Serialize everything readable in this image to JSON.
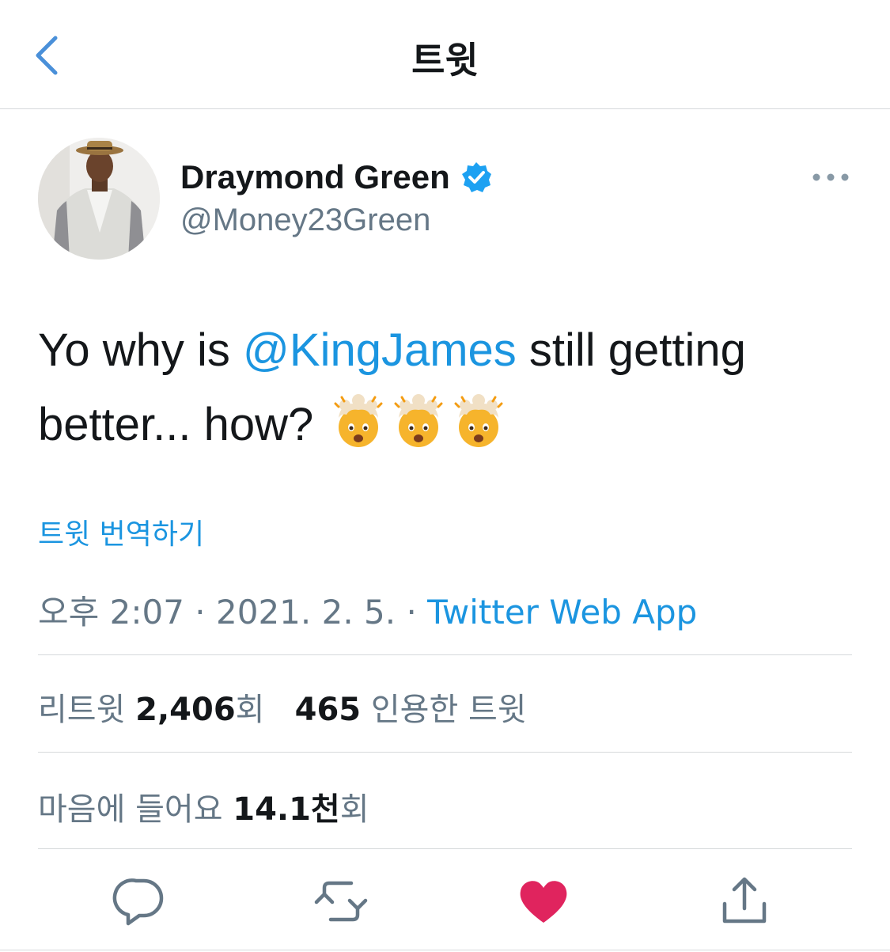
{
  "nav": {
    "title": "트윗"
  },
  "author": {
    "name": "Draymond Green",
    "handle": "@Money23Green"
  },
  "tweet": {
    "text_part1": "Yo why is ",
    "mention": "@KingJames",
    "text_part2": " still getting better... how? ",
    "emoji_count": 3,
    "emoji": "shocked-face-with-exploding-head-icon"
  },
  "translate_label": "트윗 번역하기",
  "meta": {
    "time": "오후 2:07",
    "date": "2021. 2. 5.",
    "separator": " · ",
    "source": "Twitter Web App"
  },
  "stats": {
    "retweet_label": "리트윗",
    "retweet_count": "2,406",
    "retweet_suffix": "회",
    "quote_count": "465",
    "quote_label": "인용한 트윗",
    "like_label": "마음에 들어요",
    "like_count": "14.1천",
    "like_suffix": "회"
  },
  "colors": {
    "accent": "#1b95e0",
    "like": "#e0245e",
    "secondary_text": "#657786",
    "verified": "#1da1f2"
  }
}
